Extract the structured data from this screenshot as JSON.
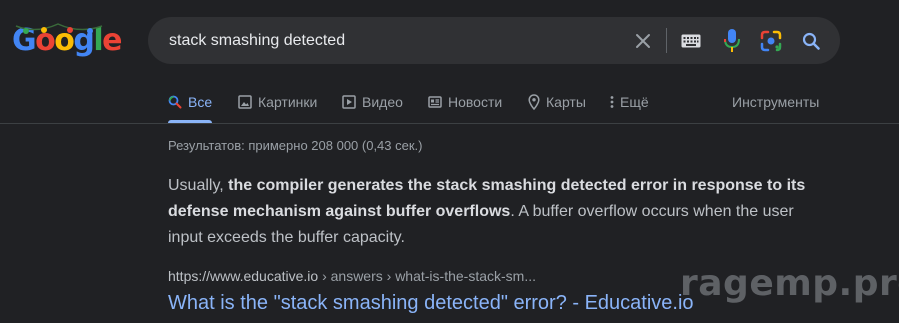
{
  "logo": {
    "letters": [
      "G",
      "o",
      "o",
      "g",
      "l",
      "e"
    ],
    "colors": [
      "#4285f4",
      "#ea4335",
      "#fbbc05",
      "#4285f4",
      "#34a853",
      "#ea4335"
    ]
  },
  "search": {
    "query": "stack smashing detected",
    "icons": [
      "close-icon",
      "keyboard-icon",
      "mic-icon",
      "camera-lens-icon",
      "search-icon"
    ]
  },
  "tabs": [
    {
      "label": "Все",
      "icon": "search-icon",
      "active": true
    },
    {
      "label": "Картинки",
      "icon": "image-icon",
      "active": false
    },
    {
      "label": "Видео",
      "icon": "video-icon",
      "active": false
    },
    {
      "label": "Новости",
      "icon": "news-icon",
      "active": false
    },
    {
      "label": "Карты",
      "icon": "map-pin-icon",
      "active": false
    },
    {
      "label": "Ещё",
      "icon": "more-vert-icon",
      "active": false
    }
  ],
  "tools_label": "Инструменты",
  "stats": "Результатов: примерно 208 000 (0,43 сек.)",
  "snippet": {
    "prefix": "Usually, ",
    "bold": "the compiler generates the stack smashing detected error in response to its defense mechanism against buffer overflows",
    "suffix": ". A buffer overflow occurs when the user input exceeds the buffer capacity."
  },
  "result": {
    "domain": "https://www.educative.io",
    "path": " › answers › what-is-the-stack-sm...",
    "title": "What is the \"stack smashing detected\" error? - Educative.io"
  },
  "watermark": "ragemp.pro",
  "colors": {
    "accent": "#8ab4f8",
    "background": "#202124",
    "search_bg": "#303134"
  }
}
